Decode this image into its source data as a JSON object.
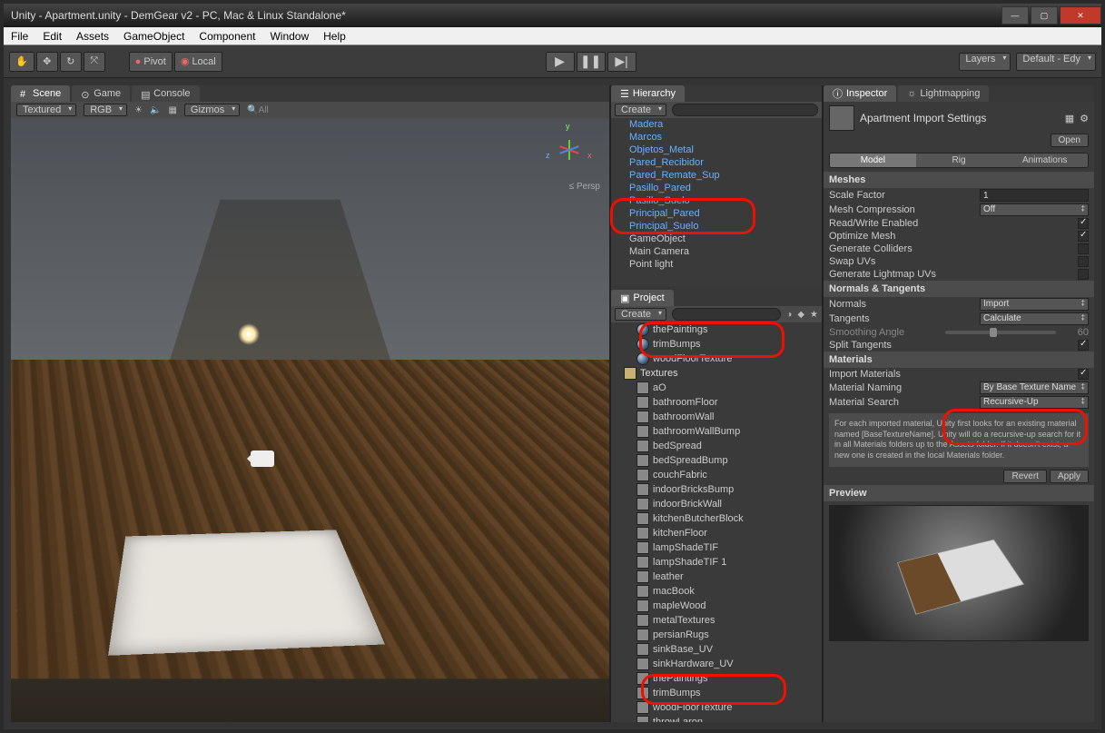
{
  "window": {
    "title": "Unity - Apartment.unity - DemGear v2 - PC, Mac & Linux Standalone*"
  },
  "menubar": [
    "File",
    "Edit",
    "Assets",
    "GameObject",
    "Component",
    "Window",
    "Help"
  ],
  "toolbar": {
    "pivot": "Pivot",
    "local": "Local",
    "layers": "Layers",
    "layout": "Default - Edy"
  },
  "scene": {
    "tabs": {
      "scene": "Scene",
      "game": "Game",
      "console": "Console"
    },
    "shading": "Textured",
    "render": "RGB",
    "gizmos": "Gizmos",
    "searchAll": "All",
    "persp": "Persp",
    "axes": {
      "x": "x",
      "y": "y",
      "z": "z"
    }
  },
  "hierarchy": {
    "title": "Hierarchy",
    "create": "Create",
    "items": [
      "Madera",
      "Marcos",
      "Objetos_Metal",
      "Pared_Recibidor",
      "Pared_Remate_Sup",
      "Pasillo_Pared",
      "Pasillo_Suelo",
      "Principal_Pared",
      "Principal_Suelo"
    ],
    "plain": [
      "GameObject",
      "Main Camera",
      "Point light"
    ]
  },
  "project": {
    "title": "Project",
    "create": "Create",
    "mats": [
      "thePaintings",
      "trimBumps",
      "woodFloorTexture"
    ],
    "folder": "Textures",
    "textures": [
      "aO",
      "bathroomFloor",
      "bathroomWall",
      "bathroomWallBump",
      "bedSpread",
      "bedSpreadBump",
      "couchFabric",
      "indoorBricksBump",
      "indoorBrickWall",
      "kitchenButcherBlock",
      "kitchenFloor",
      "lampShadeTIF",
      "lampShadeTIF 1",
      "leather",
      "macBook",
      "mapleWood",
      "metalTextures",
      "persianRugs",
      "sinkBase_UV",
      "sinkHardware_UV",
      "thePaintings",
      "trimBumps",
      "woodFloorTexture",
      "throwLaron"
    ]
  },
  "inspector": {
    "tab1": "Inspector",
    "tab2": "Lightmapping",
    "assetTitle": "Apartment Import Settings",
    "open": "Open",
    "tabs": {
      "model": "Model",
      "rig": "Rig",
      "anim": "Animations"
    },
    "meshesH": "Meshes",
    "scaleFactor": {
      "lbl": "Scale Factor",
      "val": "1"
    },
    "meshCompression": {
      "lbl": "Mesh Compression",
      "val": "Off"
    },
    "rwEnabled": "Read/Write Enabled",
    "optimize": "Optimize Mesh",
    "genColliders": "Generate Colliders",
    "swapUV": "Swap UVs",
    "genLightmap": "Generate Lightmap UVs",
    "normalsH": "Normals & Tangents",
    "normals": {
      "lbl": "Normals",
      "val": "Import"
    },
    "tangents": {
      "lbl": "Tangents",
      "val": "Calculate"
    },
    "smoothing": {
      "lbl": "Smoothing Angle",
      "val": "60"
    },
    "splitTangents": "Split Tangents",
    "materialsH": "Materials",
    "importMats": "Import Materials",
    "matNaming": {
      "lbl": "Material Naming",
      "val": "By Base Texture Name"
    },
    "matSearch": {
      "lbl": "Material Search",
      "val": "Recursive-Up"
    },
    "help": "For each imported material, Unity first looks for an existing material named [BaseTextureName].\nUnity will do a recursive-up search for it in all Materials folders up to the Assets folder.\nIf it doesn't exist, a new one is created in the local Materials folder.",
    "revert": "Revert",
    "apply": "Apply",
    "previewH": "Preview"
  }
}
